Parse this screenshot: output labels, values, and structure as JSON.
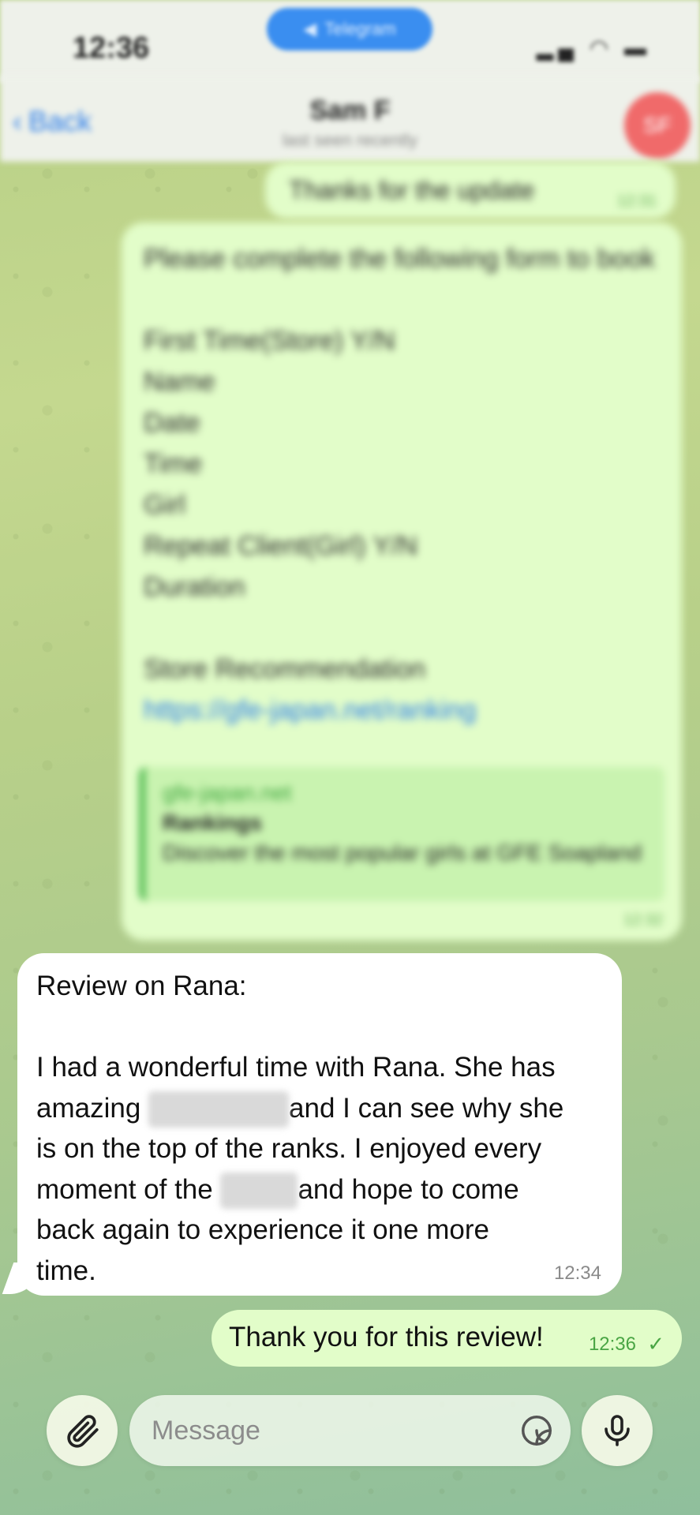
{
  "status_bar": {
    "time": "12:36",
    "pill_label": "Telegram",
    "icons": [
      "signal-icon",
      "wifi-icon",
      "battery-icon"
    ]
  },
  "header": {
    "back_label": "Back",
    "title": "Sam F",
    "subtitle": "last seen recently",
    "avatar_initials": "SF"
  },
  "messages": [
    {
      "direction": "out",
      "text": "Thanks for the update",
      "time": "12:31"
    },
    {
      "direction": "out",
      "text": "Please complete the following form to book\n\nFirst Time(Store) Y/N\nName\nDate\nTime\nGirl\nRepeat Client(Girl) Y/N\nDuration\n\nStore Recommendation",
      "link": "https://gfe-japan.net/ranking",
      "preview": {
        "site": "gfe-japan.net",
        "title": "Rankings",
        "description": "Discover the most popular girls at GFE Soapland"
      },
      "time": "12:32"
    },
    {
      "direction": "in",
      "lines": [
        "Review on Rana:",
        "",
        "I had a wonderful time with Rana. She has",
        "amazing",
        "and I can see why she",
        "is on the top of the ranks. I enjoyed every",
        "moment of the",
        "and hope to come",
        "back again to experience it one more",
        "time."
      ],
      "time": "12:34"
    },
    {
      "direction": "out",
      "text": "Thank you for this review!",
      "time": "12:36",
      "status": "check"
    }
  ],
  "composer": {
    "placeholder": "Message",
    "attach_icon": "paperclip-icon",
    "sticker_icon": "sticker-icon",
    "mic_icon": "microphone-icon"
  },
  "colors": {
    "outgoing_bubble": "#e2fdc9",
    "incoming_bubble": "#ffffff",
    "accent": "#2b7de9",
    "time_green": "#4aa544"
  }
}
